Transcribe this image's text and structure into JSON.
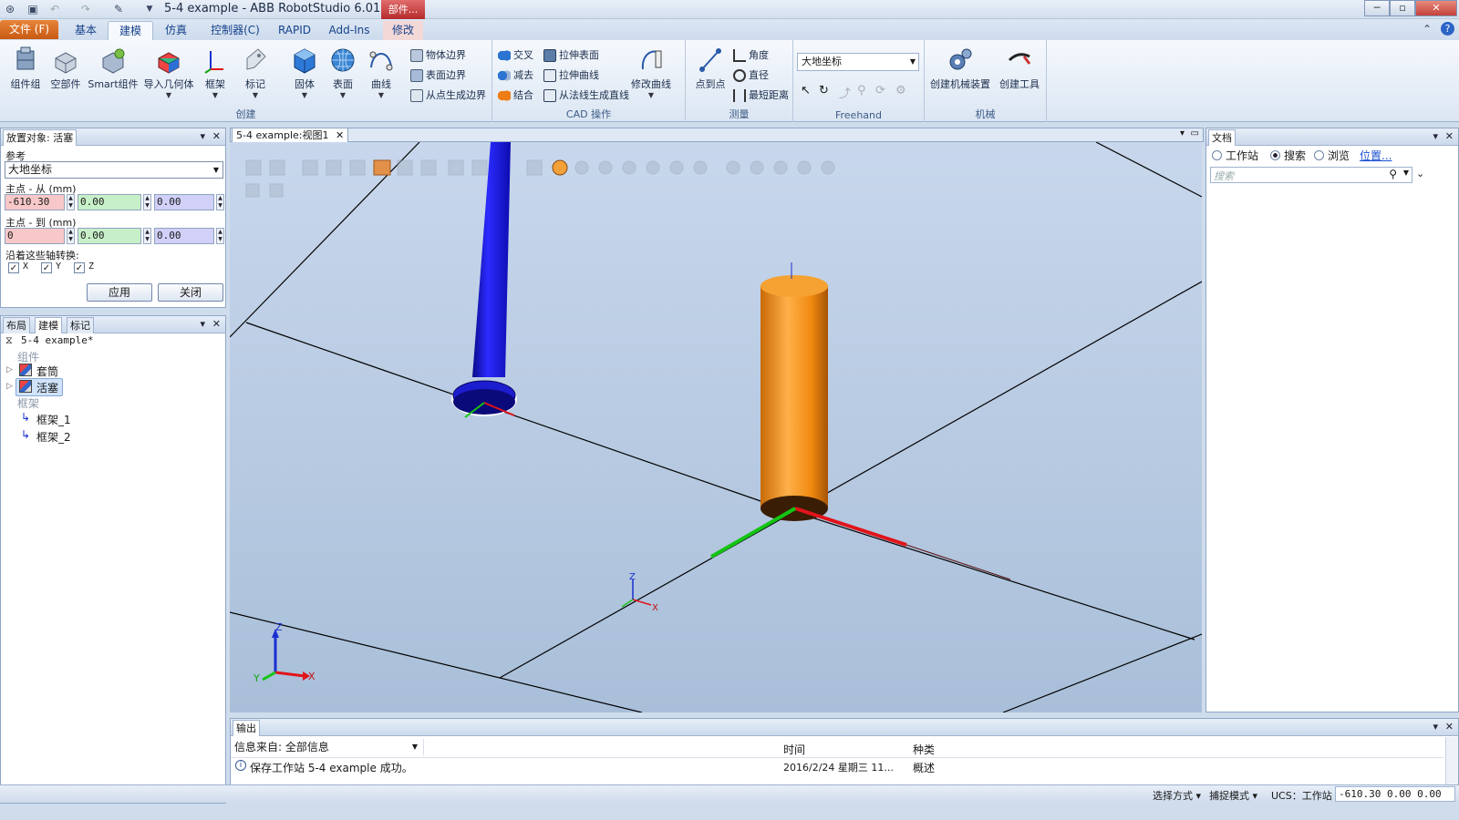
{
  "window": {
    "title": "5-4 example - ABB RobotStudio 6.01.01",
    "context_tab": "部件...",
    "min": "─",
    "max": "▫",
    "close": "✕"
  },
  "tabs": {
    "file": "文件 (F)",
    "items": [
      "基本",
      "建模",
      "仿真",
      "控制器(C)",
      "RAPID",
      "Add-Ins",
      "修改"
    ],
    "active": "建模"
  },
  "ribbon": {
    "groups": {
      "create": "创建",
      "cad": "CAD 操作",
      "measure": "测量",
      "freehand": "Freehand",
      "mechanism": "机械"
    },
    "create": {
      "component_group": "组件组",
      "empty_part": "空部件",
      "smart_component": "Smart组件",
      "import_geometry": "导入几何体",
      "frame": "框架",
      "tag": "标记",
      "solid": "固体",
      "surface": "表面",
      "curve": "曲线",
      "body_border": "物体边界",
      "surface_border": "表面边界",
      "border_from_points": "从点生成边界"
    },
    "cad": {
      "intersect": "交叉",
      "subtract": "减去",
      "union": "结合",
      "extrude_surface": "拉伸表面",
      "extrude_curve": "拉伸曲线",
      "line_from_normal": "从法线生成直线",
      "modify_curve": "修改曲线"
    },
    "measure": {
      "point_to_point": "点到点",
      "angle": "角度",
      "diameter": "直径",
      "min_distance": "最短距离"
    },
    "freehand": {
      "reference": "大地坐标"
    },
    "mechanism": {
      "create_mechanism": "创建机械装置",
      "create_tool": "创建工具"
    }
  },
  "place_panel": {
    "title": "放置对象: 活塞",
    "reference_label": "参考",
    "reference_value": "大地坐标",
    "from_label": "主点 - 从 (mm)",
    "from": [
      "-610.30",
      "0.00",
      "0.00"
    ],
    "to_label": "主点 - 到 (mm)",
    "to": [
      "0",
      "0.00",
      "0.00"
    ],
    "axes_label": "沿着这些轴转换:",
    "axes": [
      "X",
      "Y",
      "Z"
    ],
    "apply": "应用",
    "close": "关闭"
  },
  "tree_panel": {
    "tabs": [
      "布局",
      "建模",
      "标记"
    ],
    "active_tab": "建模",
    "station": "5-4 example*",
    "group_components": "组件",
    "components": [
      "套筒",
      "活塞"
    ],
    "selected_component": "活塞",
    "group_frames": "框架",
    "frames": [
      "框架_1",
      "框架_2"
    ]
  },
  "view": {
    "tab": "5-4 example:视图1",
    "axis_x": "X",
    "axis_y": "Y",
    "axis_z": "Z"
  },
  "doc_panel": {
    "title": "文档",
    "radio_station": "工作站",
    "radio_search": "搜索",
    "radio_browse": "浏览",
    "location_link": "位置...",
    "search_placeholder": "搜索",
    "selected_radio": "搜索"
  },
  "output": {
    "title": "输出",
    "filter_label": "信息来自: 全部信息",
    "col_time": "时间",
    "col_category": "种类",
    "rows": [
      {
        "message": "保存工作站 5-4 example 成功。",
        "time": "2016/2/24 星期三 11...",
        "category": "概述"
      }
    ]
  },
  "statusbar": {
    "selection_mode": "选择方式 ▾",
    "snap_mode": "捕捉模式 ▾",
    "ucs": "UCS：工作站",
    "coords": "-610.30   0.00   0.00"
  },
  "colors": {
    "accent_file": "#d5681f",
    "piston": "#1a1ae6",
    "sleeve": "#f08a10",
    "axis_x": "#e0141a",
    "axis_y": "#14c414",
    "axis_z": "#1a2fd0"
  }
}
